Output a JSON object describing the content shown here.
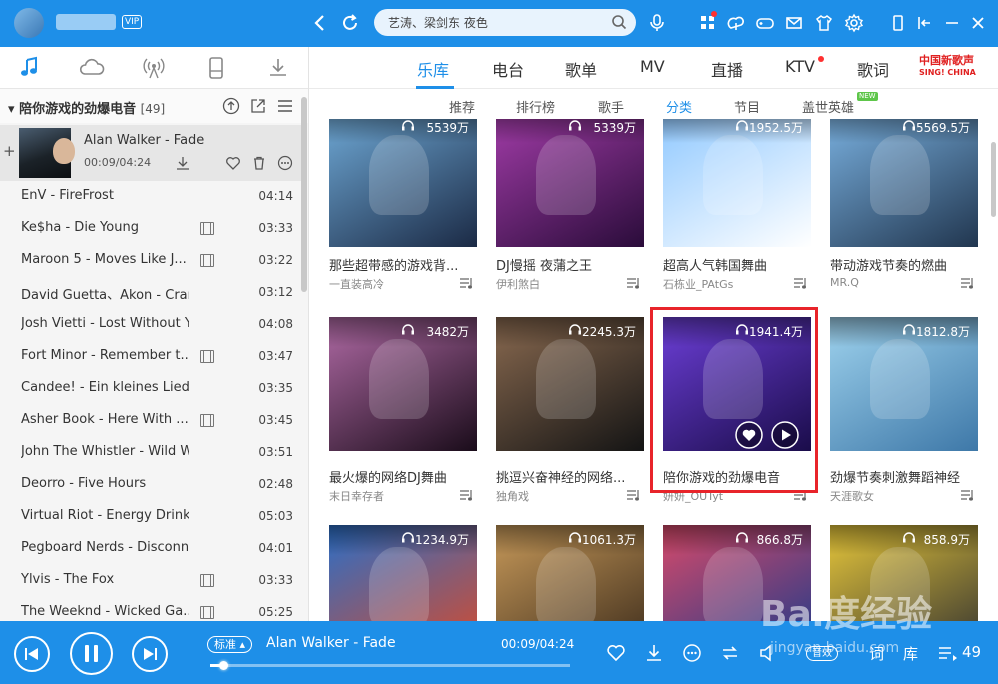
{
  "topbar": {
    "vip": "VIP",
    "search_value": "艺涛、梁剑东 夜色",
    "icons": [
      "back-icon",
      "refresh-icon",
      "microphone-icon",
      "apps-icon",
      "skin-icon",
      "game-icon",
      "mail-icon",
      "shirt-icon",
      "settings-icon",
      "mobile-icon",
      "mini-mode-icon",
      "close-icon"
    ]
  },
  "sidebar": {
    "tabs": [
      "music-note-icon",
      "cloud-icon",
      "radio-icon",
      "device-icon",
      "download-icon"
    ],
    "playlist_title": "陪你游戏的劲爆电音",
    "playlist_count": "[49]",
    "now_playing": {
      "title": "Alan Walker - Fade",
      "time": "00:09/04:24"
    },
    "tracks": [
      {
        "name": "EnV - FireFrost",
        "dur": "04:14",
        "mv": false
      },
      {
        "name": "Ke$ha - Die Young",
        "dur": "03:33",
        "mv": true
      },
      {
        "name": "Maroon 5 - Moves Like J...",
        "dur": "03:22",
        "mv": true
      },
      {
        "name": "David Guetta、Akon - Crank...",
        "dur": "03:12",
        "mv": false
      },
      {
        "name": "Josh Vietti - Lost Without You",
        "dur": "04:08",
        "mv": false
      },
      {
        "name": "Fort Minor - Remember t...",
        "dur": "03:47",
        "mv": true
      },
      {
        "name": "Candee! - Ein kleines Lied (Ar...",
        "dur": "03:35",
        "mv": false
      },
      {
        "name": "Asher Book - Here With ...",
        "dur": "03:45",
        "mv": true
      },
      {
        "name": "John The Whistler - Wild Wil...",
        "dur": "03:51",
        "mv": false
      },
      {
        "name": "Deorro - Five Hours",
        "dur": "02:48",
        "mv": false
      },
      {
        "name": "Virtual Riot - Energy Drink",
        "dur": "05:03",
        "mv": false
      },
      {
        "name": "Pegboard Nerds - Disconnec...",
        "dur": "04:01",
        "mv": false
      },
      {
        "name": "Ylvis - The Fox",
        "dur": "03:33",
        "mv": true
      },
      {
        "name": "The Weeknd - Wicked Ga...",
        "dur": "05:25",
        "mv": true
      }
    ]
  },
  "main": {
    "tabs": [
      "乐库",
      "电台",
      "歌单",
      "MV",
      "直播",
      "KTV",
      "歌词"
    ],
    "brand_line1": "中国新歌声",
    "brand_line2": "SING! CHINA",
    "subtabs": [
      "推荐",
      "排行榜",
      "歌手",
      "分类",
      "节目",
      "盖世英雄"
    ],
    "new_badge": "NEW",
    "cards": [
      {
        "title": "那些超带感的游戏背...",
        "author": "一直装高冷",
        "plays": "5539万",
        "c1": "#6fa9d6",
        "c2": "#1b2a45"
      },
      {
        "title": "DJ慢摇 夜蒲之王",
        "author": "伊利煞白",
        "plays": "5339万",
        "c1": "#a23ca8",
        "c2": "#2a0c3a"
      },
      {
        "title": "超高人气韩国舞曲",
        "author": "石栋业_PAtGs",
        "plays": "1952.5万",
        "c1": "#8fc8ff",
        "c2": "#ffffff"
      },
      {
        "title": "带动游戏节奏的燃曲",
        "author": "MR.Q",
        "plays": "5569.5万",
        "c1": "#7ab1e0",
        "c2": "#21364f"
      },
      {
        "title": "最火爆的网络DJ舞曲",
        "author": "末日幸存者",
        "plays": "3482万",
        "c1": "#b06aa5",
        "c2": "#1a0c1a"
      },
      {
        "title": "挑逗兴奋神经的网络...",
        "author": "独角戏",
        "plays": "2245.3万",
        "c1": "#8a6a50",
        "c2": "#141414"
      },
      {
        "title": "陪你游戏的劲爆电音",
        "author": "妍妍_OUTyt",
        "plays": "1941.4万",
        "c1": "#6d3fd8",
        "c2": "#1a0c4a"
      },
      {
        "title": "劲爆节奏刺激舞蹈神经",
        "author": "天涯歌女",
        "plays": "1812.8万",
        "c1": "#9fd3ee",
        "c2": "#3e78a8"
      },
      {
        "title": "",
        "author": "",
        "plays": "1234.9万",
        "c1": "#2a6fc8",
        "c2": "#d84a2a"
      },
      {
        "title": "",
        "author": "",
        "plays": "1061.3万",
        "c1": "#c89a5a",
        "c2": "#3a2a1a"
      },
      {
        "title": "",
        "author": "",
        "plays": "866.8万",
        "c1": "#d84a6a",
        "c2": "#1a3a8a"
      },
      {
        "title": "",
        "author": "",
        "plays": "858.9万",
        "c1": "#e8c83a",
        "c2": "#303030"
      }
    ]
  },
  "player": {
    "quality": "标准",
    "title": "Alan Walker - Fade",
    "time": "00:09/04:24",
    "progress": 0.035,
    "sound_effect": "音效",
    "queue_count": "49"
  },
  "watermark": {
    "main": "Bai度经验",
    "sub": "jingyan.baidu.com"
  }
}
